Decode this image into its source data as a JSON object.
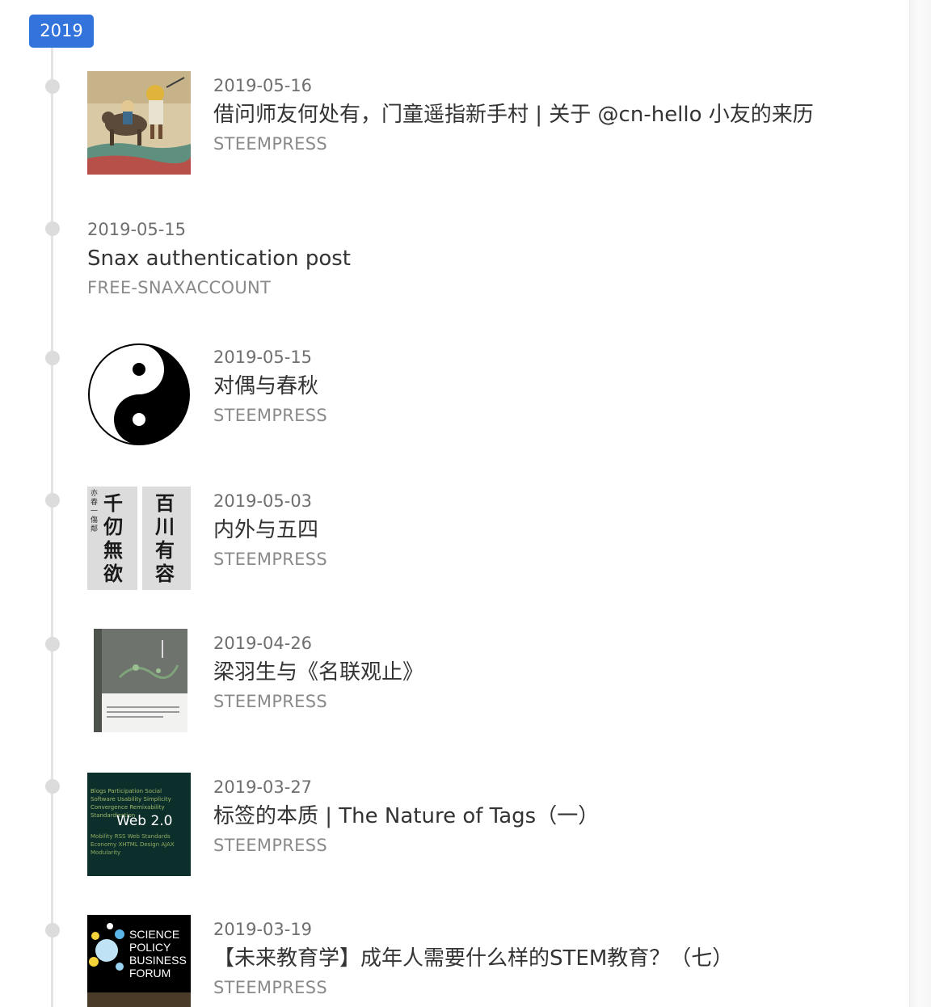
{
  "timeline": {
    "year": "2019",
    "posts": [
      {
        "date": "2019-05-16",
        "title": "借问师友何处有，门童遥指新手村 | 关于 @cn-hello 小友的来历",
        "tag": "STEEMPRESS",
        "thumb": "painting"
      },
      {
        "date": "2019-05-15",
        "title": "Snax authentication post",
        "tag": "FREE-SNAXACCOUNT",
        "thumb": ""
      },
      {
        "date": "2019-05-15",
        "title": "对偶与春秋",
        "tag": "STEEMPRESS",
        "thumb": "yin-yang"
      },
      {
        "date": "2019-05-03",
        "title": "内外与五四",
        "tag": "STEEMPRESS",
        "thumb": "calligraphy"
      },
      {
        "date": "2019-04-26",
        "title": "梁羽生与《名联观止》",
        "tag": "STEEMPRESS",
        "thumb": "book"
      },
      {
        "date": "2019-03-27",
        "title": "标签的本质 | The Nature of Tags（一）",
        "tag": "STEEMPRESS",
        "thumb": "web-2-0"
      },
      {
        "date": "2019-03-19",
        "title": "【未来教育学】成年人需要什么样的STEM教育？（七）",
        "tag": "STEEMPRESS",
        "thumb": "forum"
      }
    ],
    "thumb_text": {
      "calligraphy_left": "千仞無欲",
      "calligraphy_right": "百川有容",
      "web": "Web 2.0",
      "forum": [
        "SCIENCE",
        "POLICY",
        "BUSINESS",
        "FORUM"
      ]
    }
  }
}
